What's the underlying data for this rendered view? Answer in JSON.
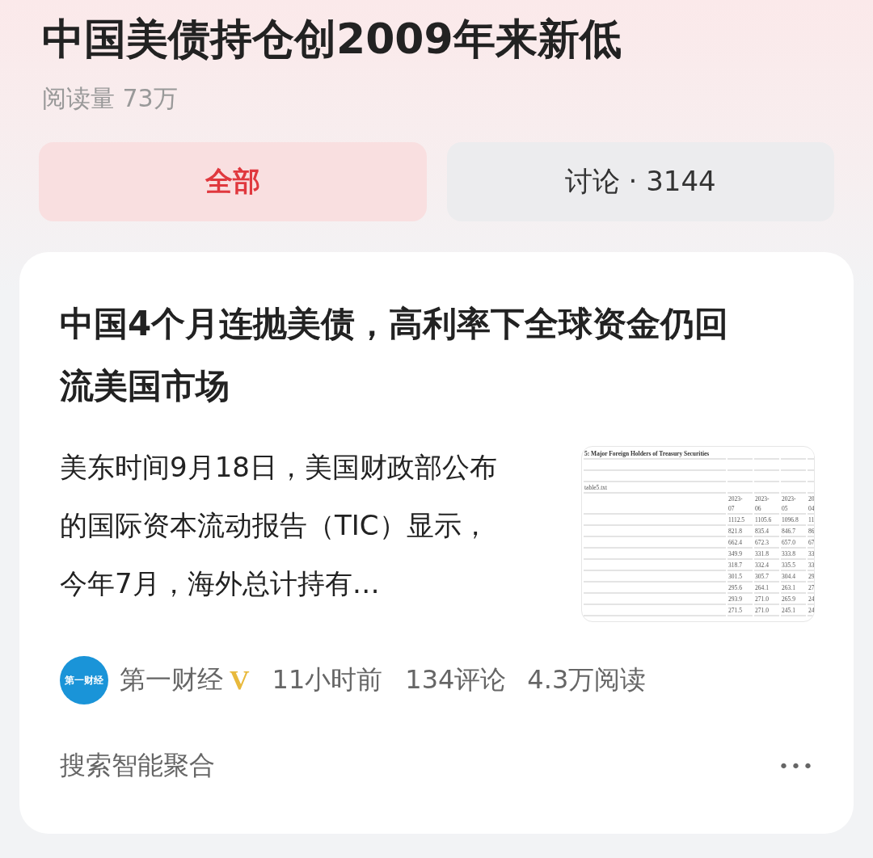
{
  "topic": {
    "title": "中国美债持仓创2009年来新低",
    "read_count": "阅读量 73万"
  },
  "tabs": [
    {
      "label": "全部",
      "selected": true
    },
    {
      "label": "讨论 · 3144",
      "selected": false
    }
  ],
  "article": {
    "headline": "中国4个月连抛美债，高利率下全球资金仍回流美国市场",
    "snippet": "美东时间9月18日，美国财政部公布的国际资本流动报告（TIC）显示，今年7月，海外总计持有…",
    "thumbnail": {
      "title": "5: Major Foreign Holders of Treasury Securities",
      "file": "table5.txt",
      "header_rows": [
        [
          "2023-",
          "2023-",
          "2023-",
          "20"
        ],
        [
          "07",
          "06",
          "05",
          "04"
        ]
      ],
      "rows": [
        [
          "1112.5",
          "1105.6",
          "1096.8",
          "11"
        ],
        [
          "821.8",
          "835.4",
          "846.7",
          "86"
        ],
        [
          "662.4",
          "672.3",
          "657.0",
          "67"
        ],
        [
          "349.9",
          "331.8",
          "333.8",
          "33"
        ],
        [
          "318.7",
          "332.4",
          "335.5",
          "33"
        ],
        [
          "301.5",
          "305.7",
          "304.4",
          "29"
        ],
        [
          "295.6",
          "264.1",
          "263.1",
          "27"
        ],
        [
          "293.9",
          "271.0",
          "265.9",
          "24"
        ],
        [
          "271.5",
          "271.0",
          "245.1",
          "24"
        ]
      ]
    },
    "source": {
      "avatar_text": "第一财经",
      "name": "第一财经",
      "verified": true,
      "badge": "V"
    },
    "time": "11小时前",
    "comments": "134评论",
    "reads": "4.3万阅读",
    "footer": "搜索智能聚合",
    "more": "•••"
  }
}
